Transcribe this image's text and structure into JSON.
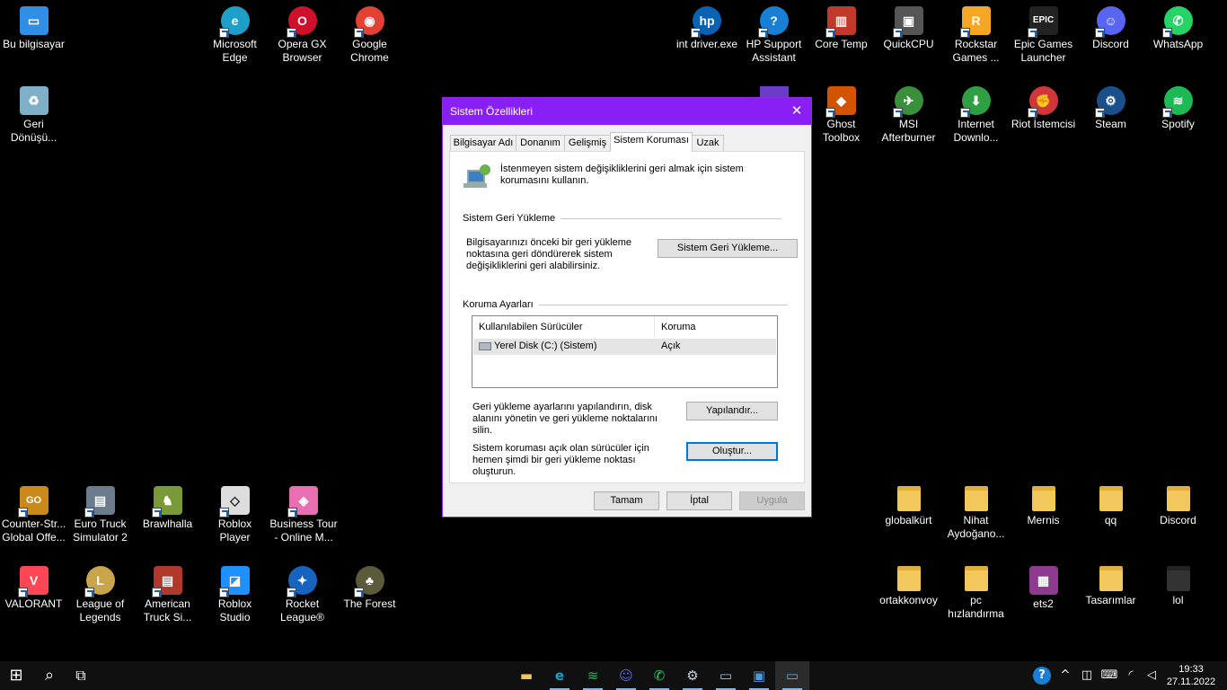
{
  "desktop_icons": [
    {
      "id": "bu-bilgisayar",
      "label": "Bu bilgisayar",
      "icon": "computer-icon",
      "glyph": "▭",
      "color": "#2f8fe6"
    },
    {
      "id": "geri-donusum",
      "label": "Geri Dönüşü...",
      "icon": "recycle-bin-icon",
      "glyph": "♻",
      "color": "#7fb0c8"
    },
    {
      "id": "edge",
      "label": "Microsoft Edge",
      "icon": "edge-icon",
      "glyph": "e",
      "color": "#1ca0c9"
    },
    {
      "id": "opera-gx",
      "label": "Opera GX Browser",
      "icon": "opera-gx-icon",
      "glyph": "O",
      "color": "#d0102b"
    },
    {
      "id": "chrome",
      "label": "Google Chrome",
      "icon": "chrome-icon",
      "glyph": "◉",
      "color": "#e34133"
    },
    {
      "id": "int-driver",
      "label": "int driver.exe",
      "icon": "hp-icon",
      "glyph": "hp",
      "color": "#0a62b5"
    },
    {
      "id": "hp-support",
      "label": "HP Support Assistant",
      "icon": "help-icon",
      "glyph": "?",
      "color": "#1780d6"
    },
    {
      "id": "core-temp",
      "label": "Core Temp",
      "icon": "thermometer-icon",
      "glyph": "▥",
      "color": "#c0392b"
    },
    {
      "id": "quickcpu",
      "label": "QuickCPU",
      "icon": "cpu-icon",
      "glyph": "▣",
      "color": "#555555"
    },
    {
      "id": "rockstar",
      "label": "Rockstar Games ...",
      "icon": "rockstar-icon",
      "glyph": "R",
      "color": "#f5a623"
    },
    {
      "id": "epic",
      "label": "Epic Games Launcher",
      "icon": "epic-icon",
      "glyph": "EPIC",
      "color": "#222222"
    },
    {
      "id": "discord",
      "label": "Discord",
      "icon": "discord-icon",
      "glyph": "☺",
      "color": "#5865f2"
    },
    {
      "id": "whatsapp",
      "label": "WhatsApp",
      "icon": "whatsapp-icon",
      "glyph": "✆",
      "color": "#25d366"
    },
    {
      "id": "ghost-toolbox",
      "label": "Ghost Toolbox",
      "icon": "toolbox-icon",
      "glyph": "◆",
      "color": "#d35400"
    },
    {
      "id": "msi-afterburner",
      "label": "MSI Afterburner",
      "icon": "afterburner-icon",
      "glyph": "✈",
      "color": "#3a8f3a"
    },
    {
      "id": "idm",
      "label": "Internet Downlo...",
      "icon": "download-icon",
      "glyph": "⬇",
      "color": "#2ea043"
    },
    {
      "id": "riot",
      "label": "Riot İstemcisi",
      "icon": "riot-icon",
      "glyph": "✊",
      "color": "#d13639"
    },
    {
      "id": "steam",
      "label": "Steam",
      "icon": "steam-icon",
      "glyph": "⚙",
      "color": "#1b4f8a"
    },
    {
      "id": "spotify",
      "label": "Spotify",
      "icon": "spotify-icon",
      "glyph": "≋",
      "color": "#1db954"
    },
    {
      "id": "csgo",
      "label": "Counter-Str... Global Offe...",
      "icon": "csgo-icon",
      "glyph": "GO",
      "color": "#c98a1b"
    },
    {
      "id": "ets2",
      "label": "Euro Truck Simulator 2",
      "icon": "truck-icon",
      "glyph": "▤",
      "color": "#6d7c8c"
    },
    {
      "id": "brawlhalla",
      "label": "Brawlhalla",
      "icon": "brawlhalla-icon",
      "glyph": "♞",
      "color": "#7a9a3a"
    },
    {
      "id": "roblox-player",
      "label": "Roblox Player",
      "icon": "roblox-icon",
      "glyph": "◇",
      "color": "#dddddd"
    },
    {
      "id": "business-tour",
      "label": "Business Tour - Online M...",
      "icon": "business-tour-icon",
      "glyph": "◈",
      "color": "#e86fb2"
    },
    {
      "id": "globalkurt",
      "label": "globalkürt",
      "icon": "folder-icon",
      "glyph": "",
      "color": "#f2c75c"
    },
    {
      "id": "nihat",
      "label": "Nihat Aydoğano...",
      "icon": "folder-icon",
      "glyph": "",
      "color": "#f2c75c"
    },
    {
      "id": "mernis",
      "label": "Mernis",
      "icon": "folder-icon",
      "glyph": "",
      "color": "#f2c75c"
    },
    {
      "id": "qq",
      "label": "qq",
      "icon": "folder-icon",
      "glyph": "",
      "color": "#f2c75c"
    },
    {
      "id": "discord-folder",
      "label": "Discord",
      "icon": "folder-icon",
      "glyph": "",
      "color": "#f2c75c"
    },
    {
      "id": "valorant",
      "label": "VALORANT",
      "icon": "valorant-icon",
      "glyph": "V",
      "color": "#ff4655"
    },
    {
      "id": "lol",
      "label": "League of Legends",
      "icon": "league-icon",
      "glyph": "L",
      "color": "#c8a44a"
    },
    {
      "id": "ats",
      "label": "American Truck Si...",
      "icon": "truck-icon",
      "glyph": "▤",
      "color": "#b0392b"
    },
    {
      "id": "roblox-studio",
      "label": "Roblox Studio",
      "icon": "roblox-studio-icon",
      "glyph": "◪",
      "color": "#1e90ff"
    },
    {
      "id": "rocket-league",
      "label": "Rocket League®",
      "icon": "rocket-league-icon",
      "glyph": "✦",
      "color": "#1565c0"
    },
    {
      "id": "the-forest",
      "label": "The Forest",
      "icon": "forest-icon",
      "glyph": "♣",
      "color": "#5b5b3b"
    },
    {
      "id": "ortakkonvoy",
      "label": "ortakkonvoy",
      "icon": "folder-icon",
      "glyph": "",
      "color": "#f2c75c"
    },
    {
      "id": "pc-hizlandirma",
      "label": "pc hızlandırma",
      "icon": "folder-icon",
      "glyph": "",
      "color": "#f2c75c"
    },
    {
      "id": "ets2-folder",
      "label": "ets2",
      "icon": "winrar-icon",
      "glyph": "▦",
      "color": "#8e3a8e"
    },
    {
      "id": "tasarimlar",
      "label": "Tasarımlar",
      "icon": "folder-icon",
      "glyph": "",
      "color": "#f2c75c"
    },
    {
      "id": "lol-folder",
      "label": "lol",
      "icon": "folder-icon",
      "glyph": "",
      "color": "#f2c75c"
    }
  ],
  "dialog": {
    "title": "Sistem Özellikleri",
    "close_glyph": "✕",
    "tabs": [
      "Bilgisayar Adı",
      "Donanım",
      "Gelişmiş",
      "Sistem Koruması",
      "Uzak"
    ],
    "active_tab": "Sistem Koruması",
    "intro": "İstenmeyen sistem değişikliklerini geri almak için sistem korumasını kullanın.",
    "restore_group": "Sistem Geri Yükleme",
    "restore_text": "Bilgisayarınızı önceki bir geri yükleme noktasına geri döndürerek sistem değişikliklerini geri alabilirsiniz.",
    "restore_button": "Sistem Geri Yükleme...",
    "protection_group": "Koruma Ayarları",
    "table_headers": [
      "Kullanılabilen Sürücüler",
      "Koruma"
    ],
    "drives": [
      {
        "name": "Yerel Disk (C:) (Sistem)",
        "protection": "Açık"
      }
    ],
    "configure_text": "Geri yükleme ayarlarını yapılandırın, disk alanını yönetin ve geri yükleme noktalarını silin.",
    "configure_button": "Yapılandır...",
    "create_text": "Sistem koruması açık olan sürücüler için hemen şimdi bir geri yükleme noktası oluşturun.",
    "create_button": "Oluştur...",
    "ok_button": "Tamam",
    "cancel_button": "İptal",
    "apply_button": "Uygula"
  },
  "taskbar": {
    "start_glyph": "⊞",
    "search_glyph": "⌕",
    "taskview_glyph": "⧉",
    "apps": [
      {
        "id": "explorer",
        "icon": "file-explorer-icon",
        "glyph": "▬",
        "color": "#f2c75c"
      },
      {
        "id": "edge",
        "icon": "edge-icon",
        "glyph": "e",
        "color": "#1ca0c9"
      },
      {
        "id": "spotify",
        "icon": "spotify-icon",
        "glyph": "≋",
        "color": "#1db954"
      },
      {
        "id": "discord",
        "icon": "discord-icon",
        "glyph": "☺",
        "color": "#5865f2"
      },
      {
        "id": "whatsapp",
        "icon": "whatsapp-icon",
        "glyph": "✆",
        "color": "#25d366"
      },
      {
        "id": "steam",
        "icon": "steam-icon",
        "glyph": "⚙",
        "color": "#c7d5e0"
      },
      {
        "id": "network",
        "icon": "network-icon",
        "glyph": "▭",
        "color": "#9ec6e8"
      },
      {
        "id": "outlook",
        "icon": "window-icon",
        "glyph": "▣",
        "color": "#4f9bd9"
      },
      {
        "id": "system-properties",
        "icon": "system-properties-icon",
        "glyph": "▭",
        "color": "#6fa8dc"
      }
    ],
    "tray": {
      "help_glyph": "?",
      "chevron_glyph": "^",
      "camera_glyph": "◫",
      "keyboard_glyph": "⌨",
      "wifi_glyph": "◜",
      "volume_glyph": "◁"
    },
    "time": "19:33",
    "date": "27.11.2022"
  }
}
